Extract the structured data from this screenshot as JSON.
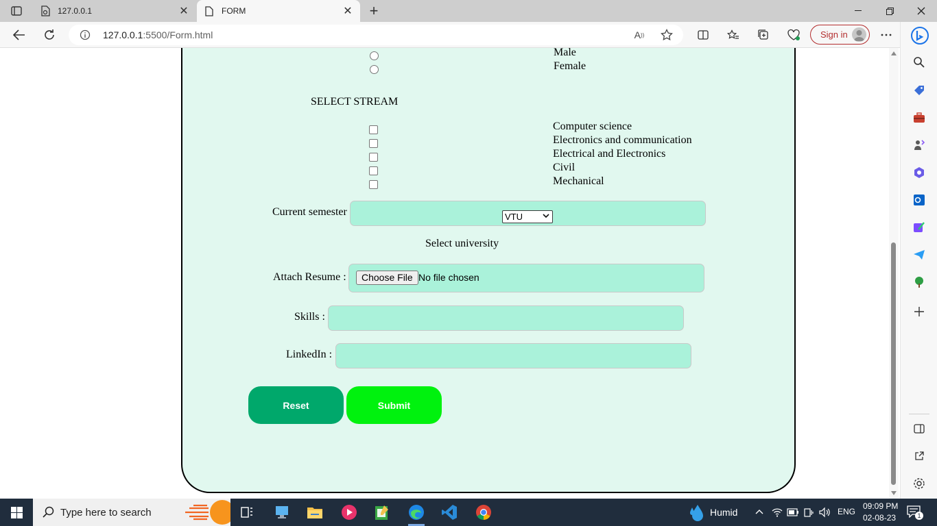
{
  "browser": {
    "tabs": [
      {
        "title": "127.0.0.1",
        "active": false
      },
      {
        "title": "FORM",
        "active": true
      }
    ],
    "address": {
      "host": "127.0.0.1",
      "path": ":5500/Form.html"
    },
    "signin_label": "Sign in"
  },
  "form": {
    "gender_options": [
      "Male",
      "Female"
    ],
    "stream_heading": "SELECT STREAM",
    "streams": [
      "Computer science",
      "Electronics and communication",
      "Electrical and Electronics",
      "Civil",
      "Mechanical"
    ],
    "semester_label": "Current semester",
    "semester_value": "",
    "university_label": "Select university",
    "university_selected": "VTU",
    "resume_label": "Attach Resume :",
    "resume_button": "Choose File",
    "resume_status": "No file chosen",
    "skills_label": "Skills :",
    "skills_value": "",
    "linkedin_label": "LinkedIn :",
    "linkedin_value": "",
    "reset_label": "Reset",
    "submit_label": "Submit",
    "colors": {
      "card_bg": "#e1f8ef",
      "field_bg": "#aaf2da",
      "reset_bg": "#00a86b",
      "submit_bg": "#00f20e"
    }
  },
  "taskbar": {
    "search_placeholder": "Type here to search",
    "weather": "Humid",
    "language": "ENG",
    "time": "09:09 PM",
    "date": "02-08-23",
    "notification_count": "1"
  }
}
